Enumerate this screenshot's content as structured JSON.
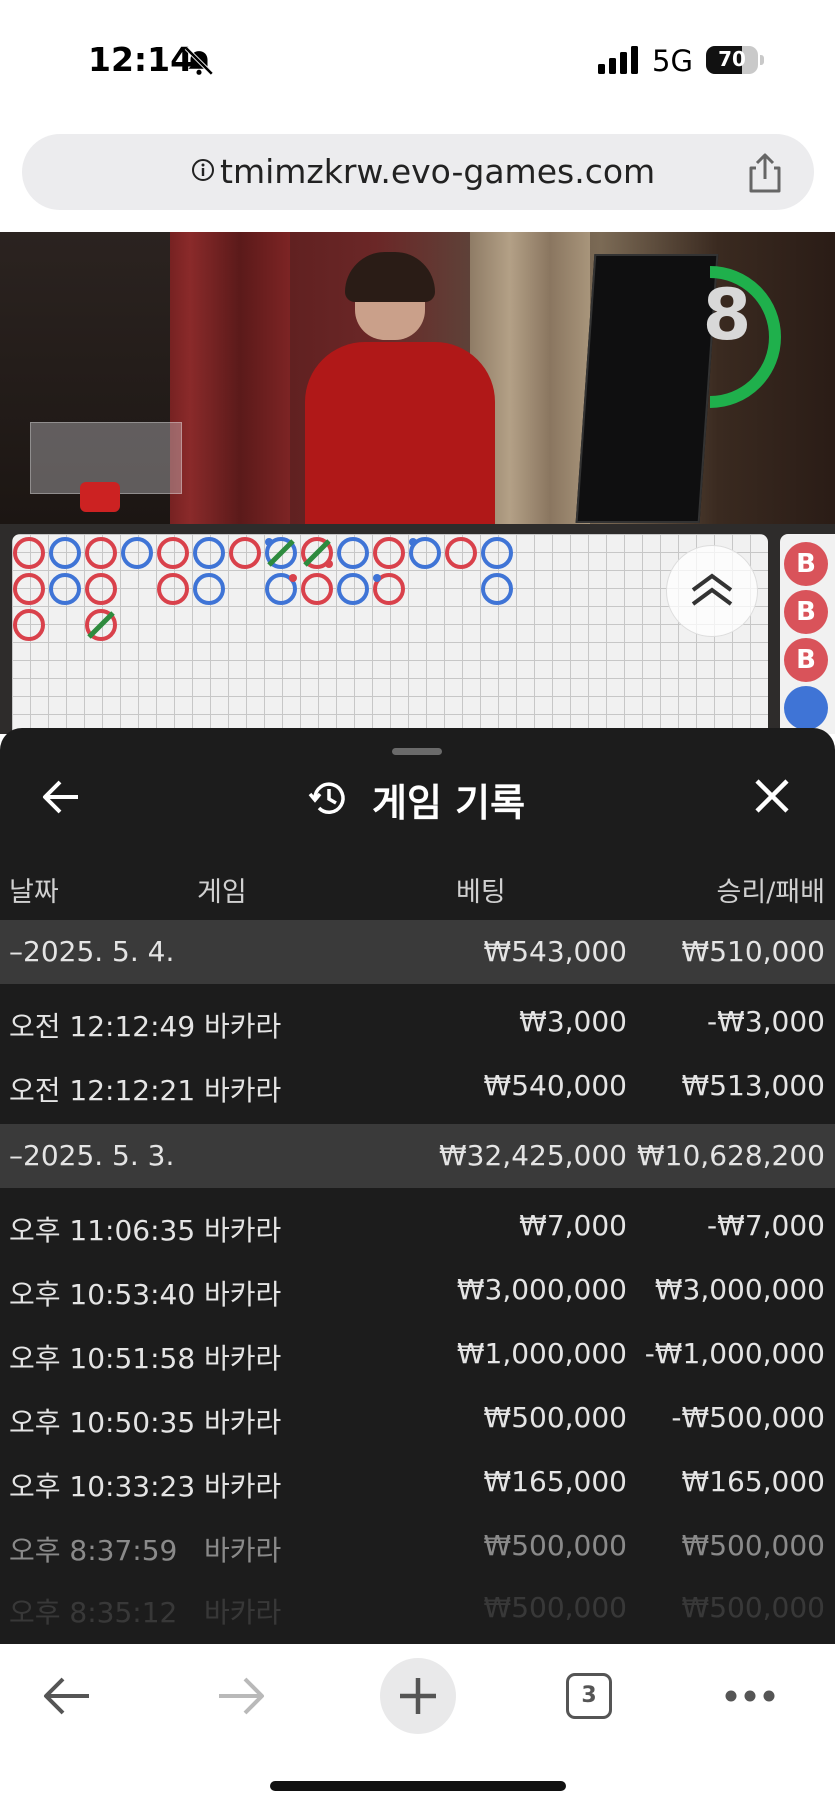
{
  "status_bar": {
    "time": "12:14",
    "network": "5G",
    "battery": "70"
  },
  "browser": {
    "url": "tmimzkrw.evo-games.com",
    "tab_count": "3"
  },
  "video": {
    "countdown": "8"
  },
  "road": {
    "side_label": "B"
  },
  "panel": {
    "title": "게임 기록",
    "columns": {
      "date": "날짜",
      "game": "게임",
      "bet": "베팅",
      "result": "승리/패배"
    },
    "groups": [
      {
        "date": "–2025. 5. 4.",
        "bet": "₩543,000",
        "result": "₩510,000",
        "rows": [
          {
            "time": "오전 12:12:49",
            "game": "바카라",
            "bet": "₩3,000",
            "result": "-₩3,000"
          },
          {
            "time": "오전 12:12:21",
            "game": "바카라",
            "bet": "₩540,000",
            "result": "₩513,000"
          }
        ]
      },
      {
        "date": "–2025. 5. 3.",
        "bet": "₩32,425,000",
        "result": "₩10,628,200",
        "rows": [
          {
            "time": "오후 11:06:35",
            "game": "바카라",
            "bet": "₩7,000",
            "result": "-₩7,000"
          },
          {
            "time": "오후 10:53:40",
            "game": "바카라",
            "bet": "₩3,000,000",
            "result": "₩3,000,000"
          },
          {
            "time": "오후 10:51:58",
            "game": "바카라",
            "bet": "₩1,000,000",
            "result": "-₩1,000,000"
          },
          {
            "time": "오후 10:50:35",
            "game": "바카라",
            "bet": "₩500,000",
            "result": "-₩500,000"
          },
          {
            "time": "오후 10:33:23",
            "game": "바카라",
            "bet": "₩165,000",
            "result": "₩165,000"
          },
          {
            "time": "오후 8:37:59",
            "game": "바카라",
            "bet": "₩500,000",
            "result": "₩500,000"
          },
          {
            "time": "오후 8:35:12",
            "game": "바카라",
            "bet": "₩500,000",
            "result": "₩500,000"
          }
        ]
      }
    ]
  },
  "colors": {
    "banker": "#d9414b",
    "player": "#3f74d6",
    "tie": "#2e8b3e",
    "timer": "#1fb04c",
    "panel_bg": "#1c1c1c"
  },
  "icons": [
    "bell-slash-icon",
    "signal-icon",
    "info-icon",
    "share-icon",
    "chevron-up-icon",
    "back-arrow-icon",
    "history-icon",
    "close-icon",
    "forward-arrow-icon",
    "plus-icon",
    "more-icon"
  ]
}
